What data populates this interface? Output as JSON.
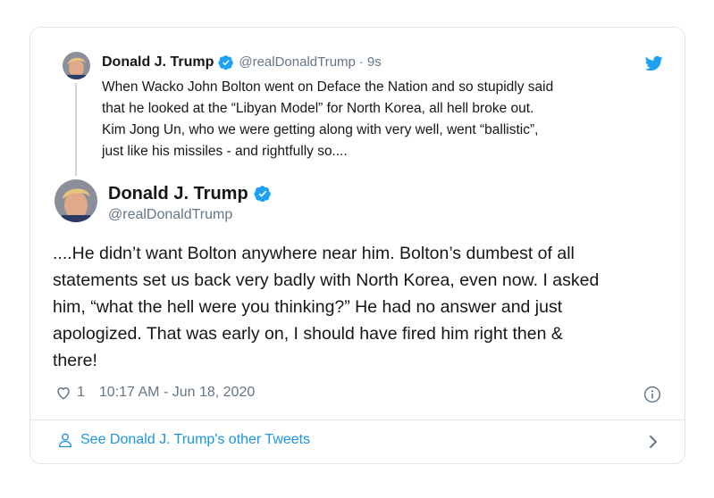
{
  "colors": {
    "accent": "#1da1f2",
    "link": "#1b95e0",
    "muted": "#657786",
    "text": "#14171a",
    "border": "#e1e8ed"
  },
  "parent_tweet": {
    "author_name": "Donald J. Trump",
    "handle": "@realDonaldTrump",
    "separator": "·",
    "time": "9s",
    "text_lines": [
      "When Wacko John Bolton went on Deface the Nation and so stupidly said",
      "that he looked at the “Libyan Model” for North Korea, all hell broke out.",
      "Kim Jong Un, who we were getting along with very well, went “ballistic”,",
      "just like his missiles - and rightfully so...."
    ]
  },
  "main_tweet": {
    "author_name": "Donald J. Trump",
    "handle": "@realDonaldTrump",
    "text_lines": [
      "....He didn’t want Bolton anywhere near him. Bolton’s dumbest of all",
      "statements set us back very badly with North Korea, even now. I asked",
      "him, “what the hell were you thinking?” He had no answer and just",
      "apologized. That was early on, I should have fired him right then &",
      "there!"
    ],
    "like_count": "1",
    "timestamp": "10:17 AM - Jun 18, 2020"
  },
  "footer": {
    "link_label": "See Donald J. Trump's other Tweets"
  },
  "icons": {
    "logo": "twitter-bird-icon",
    "verified": "verified-badge-icon",
    "like": "heart-icon",
    "info": "info-icon",
    "profile": "person-icon",
    "more": "chevron-right-icon"
  }
}
